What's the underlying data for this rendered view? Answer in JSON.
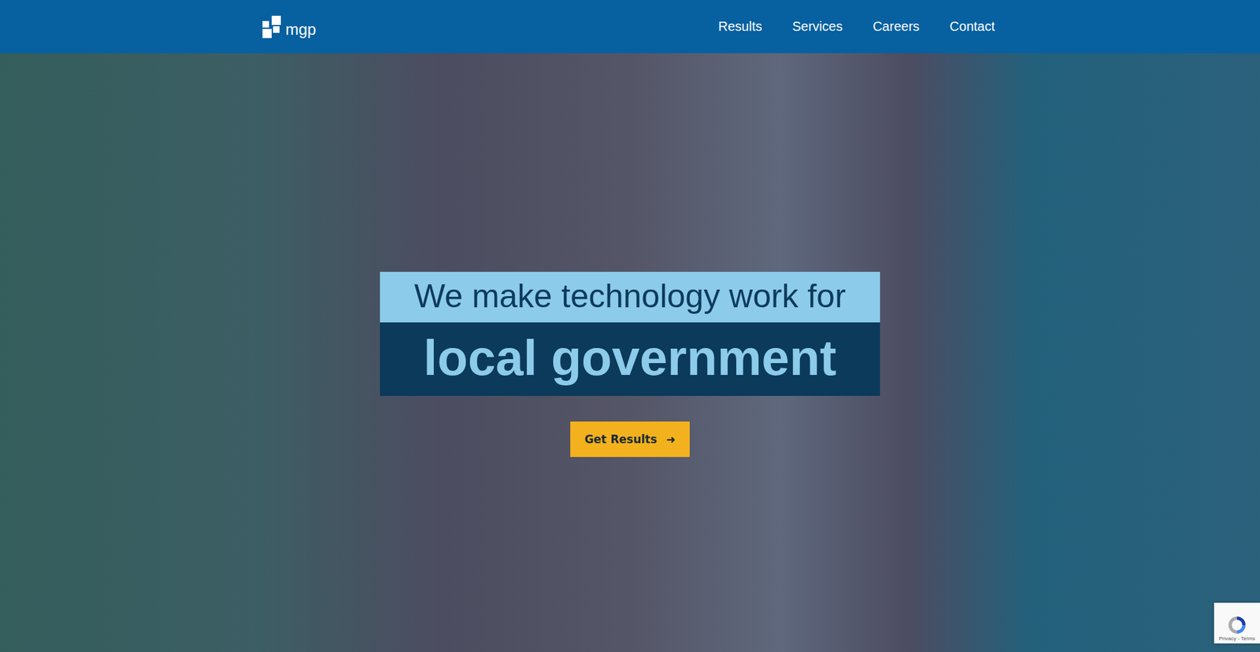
{
  "header": {
    "logo": "mgp",
    "nav": [
      {
        "label": "Results",
        "has_dropdown": true
      },
      {
        "label": "Services",
        "has_dropdown": true
      },
      {
        "label": "Careers",
        "has_dropdown": false
      },
      {
        "label": "Contact",
        "has_dropdown": false
      }
    ]
  },
  "hero": {
    "line1": "We make technology work for",
    "line2": "local government",
    "button": {
      "label": "Get Results",
      "icon": "➜"
    }
  },
  "recaptcha": {
    "links": "Privacy - Terms"
  }
}
